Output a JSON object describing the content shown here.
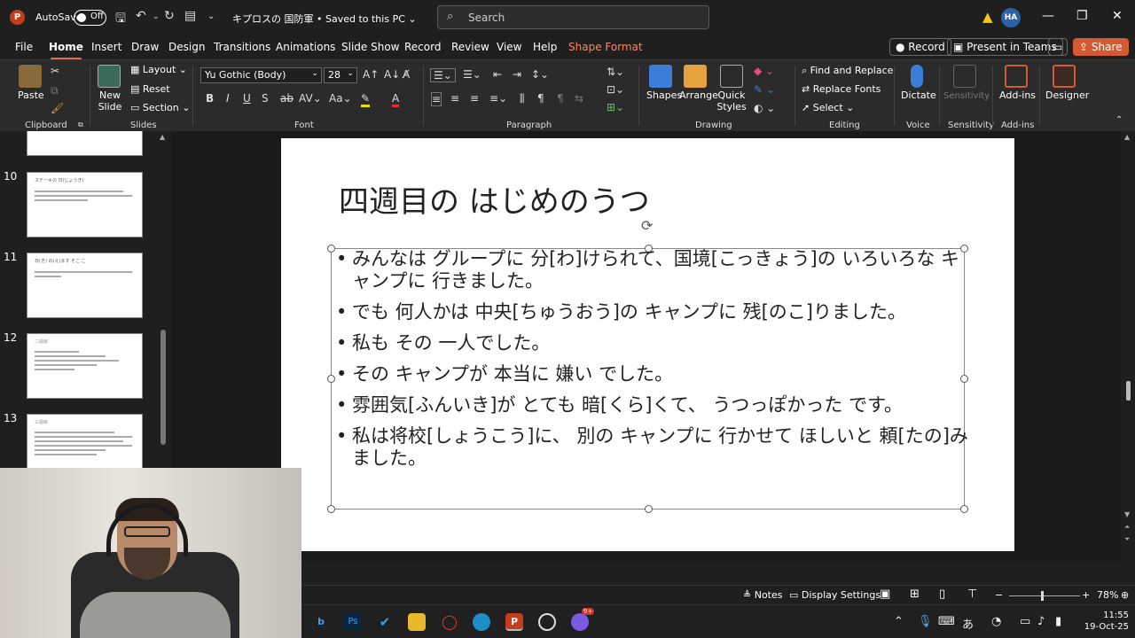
{
  "titlebar": {
    "app_letter": "P",
    "autosave_label": "AutoSave",
    "autosave_state": "Off",
    "document_title": "キプロスの 国防軍 • Saved to this PC ⌄",
    "search_placeholder": "Search",
    "user_initials": "HA"
  },
  "tabs": [
    "File",
    "Home",
    "Insert",
    "Draw",
    "Design",
    "Transitions",
    "Animations",
    "Slide Show",
    "Record",
    "Review",
    "View",
    "Help",
    "Shape Format"
  ],
  "tab_buttons": {
    "record": "Record",
    "present": "Present in Teams",
    "share": "Share"
  },
  "ribbon": {
    "clipboard": {
      "paste": "Paste",
      "group": "Clipboard"
    },
    "slides": {
      "new_slide": "New Slide",
      "layout": "Layout",
      "reset": "Reset",
      "section": "Section",
      "group": "Slides"
    },
    "font": {
      "family": "Yu Gothic (Body)",
      "size": "28",
      "group": "Font"
    },
    "paragraph": {
      "group": "Paragraph"
    },
    "drawing": {
      "shapes": "Shapes",
      "arrange": "Arrange",
      "quick_styles": "Quick Styles",
      "group": "Drawing"
    },
    "editing": {
      "find_replace": "Find and Replace",
      "replace_fonts": "Replace Fonts",
      "select": "Select",
      "group": "Editing"
    },
    "voice": {
      "dictate": "Dictate",
      "group": "Voice"
    },
    "sensitivity": {
      "label": "Sensitivity",
      "group": "Sensitivity"
    },
    "addins": {
      "label": "Add-ins",
      "group": "Add-ins"
    },
    "designer": {
      "label": "Designer"
    }
  },
  "slide_panel": {
    "slides": [
      {
        "number": "10",
        "title": "ステーキの 日(じょうき)"
      },
      {
        "number": "11",
        "title": "日(き) の(え)ます そこ こ"
      },
      {
        "number": "12",
        "title": "二週目"
      },
      {
        "number": "13",
        "title": "三週目"
      }
    ]
  },
  "slide": {
    "title": "四週目の はじめのうつ",
    "bullets": [
      "みんなは グループに 分[わ]けられて、国境[こっきょう]の いろいろな キャンプに 行きました。",
      "でも 何人かは 中央[ちゅうおう]の キャンプに 残[のこ]りました。",
      "私も その 一人でした。",
      "その キャンプが 本当に 嫌い でした。",
      "雰囲気[ふんいき]が とても 暗[くら]くて、 うつっぽかった です。",
      "私は将校[しょうこう]に、 別の キャンプに 行かせて ほしいと 頼[たの]みました。"
    ]
  },
  "statusbar": {
    "notes": "Notes",
    "display_settings": "Display Settings",
    "zoom": "78%"
  },
  "taskbar": {
    "time": "11:55",
    "date": "19-Oct-25",
    "badge": "9+"
  },
  "colors": {
    "accent": "#e36c4a",
    "shape_format": "#f08a6a",
    "share": "#d45a32",
    "app": "#c43e1c"
  }
}
